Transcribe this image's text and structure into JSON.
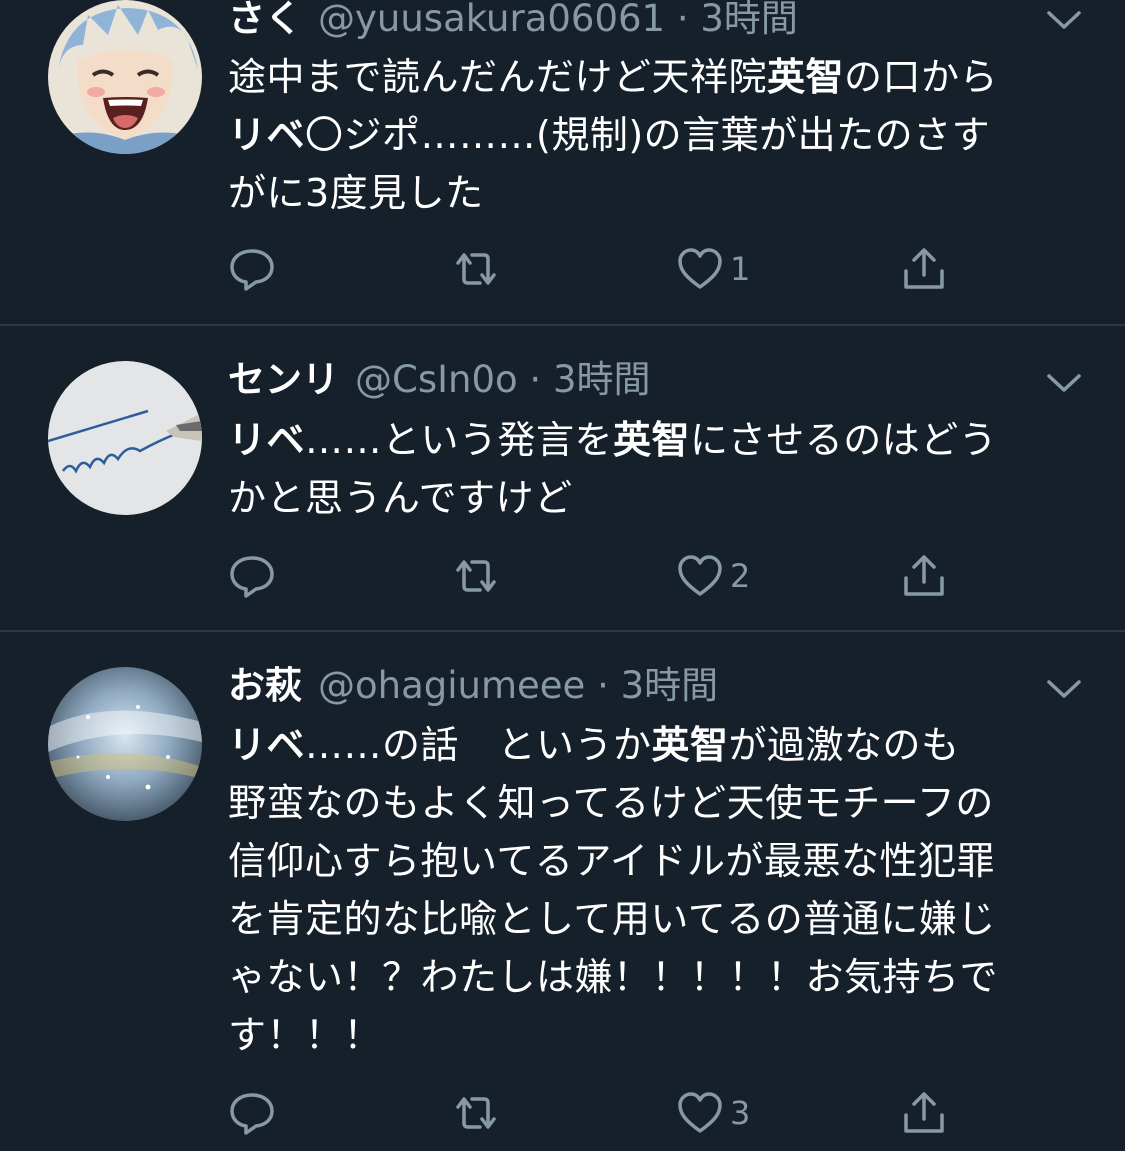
{
  "tweets": [
    {
      "name": "さく",
      "handle": "@yuusakura06061",
      "time": "3時間",
      "lines": [
        [
          {
            "t": "途中まで読んだんだけど天祥院",
            "b": false
          },
          {
            "t": "英智",
            "b": true
          },
          {
            "t": "の口から",
            "b": false
          }
        ],
        [
          {
            "t": "リベ",
            "b": true
          },
          {
            "t": "〇ジポ………(規制)の言葉が出たのさす",
            "b": false
          }
        ],
        [
          {
            "t": "がに3度見した",
            "b": false
          }
        ]
      ],
      "likes": "1"
    },
    {
      "name": "センリ",
      "handle": "@CsIn0o",
      "time": "3時間",
      "lines": [
        [
          {
            "t": "リベ",
            "b": true
          },
          {
            "t": "……という発言を",
            "b": false
          },
          {
            "t": "英智",
            "b": true
          },
          {
            "t": "にさせるのはどう",
            "b": false
          }
        ],
        [
          {
            "t": "かと思うんですけど",
            "b": false
          }
        ]
      ],
      "likes": "2"
    },
    {
      "name": "お萩",
      "handle": "@ohagiumeee",
      "time": "3時間",
      "lines": [
        [
          {
            "t": "リベ",
            "b": true
          },
          {
            "t": "……の話　というか",
            "b": false
          },
          {
            "t": "英智",
            "b": true
          },
          {
            "t": "が過激なのも",
            "b": false
          }
        ],
        [
          {
            "t": "野蛮なのもよく知ってるけど天使モチーフの",
            "b": false
          }
        ],
        [
          {
            "t": "信仰心すら抱いてるアイドルが最悪な性犯罪",
            "b": false
          }
        ],
        [
          {
            "t": "を肯定的な比喩として用いてるの普通に嫌じ",
            "b": false
          }
        ],
        [
          {
            "t": "ゃない！？わたしは嫌！！！！！お気持ちで",
            "b": false
          }
        ],
        [
          {
            "t": "す！！！",
            "b": false
          }
        ]
      ],
      "likes": "3"
    }
  ],
  "colors": {
    "background": "#15202b",
    "text": "#ffffff",
    "secondary": "#8899a6",
    "divider": "#2b3947"
  },
  "icons": [
    "reply-icon",
    "retweet-icon",
    "like-icon",
    "share-icon",
    "chevron-down-icon"
  ]
}
